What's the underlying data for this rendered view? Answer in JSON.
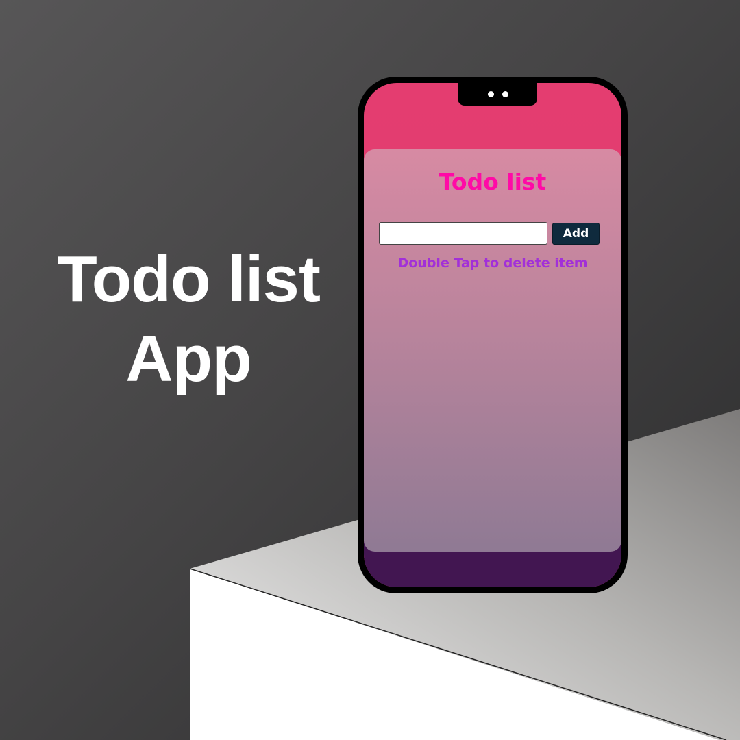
{
  "promo": {
    "headline_line1": "Todo list",
    "headline_line2": "App"
  },
  "app": {
    "title": "Todo list",
    "input": {
      "value": "",
      "placeholder": ""
    },
    "add_button_label": "Add",
    "hint": "Double Tap to delete item"
  },
  "colors": {
    "title": "#ff0aa6",
    "hint": "#a230d8",
    "add_button_bg": "#0f2a3d",
    "screen_top": "#e43d70",
    "screen_bottom": "#421651"
  },
  "icons": {
    "notch": "phone-notch-icon"
  }
}
